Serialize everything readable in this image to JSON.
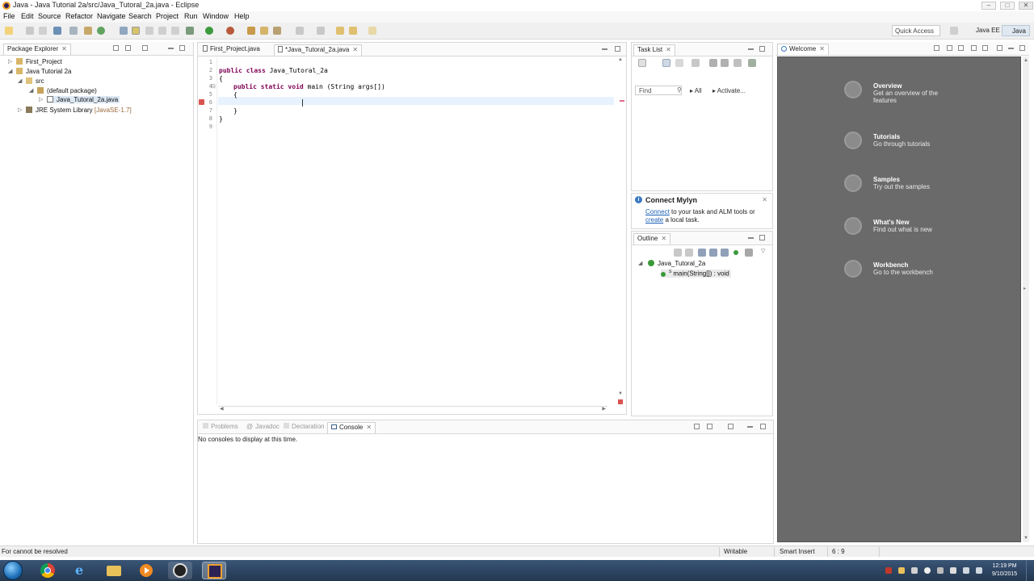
{
  "window": {
    "title": "Java - Java Tutorial 2a/src/Java_Tutoral_2a.java - Eclipse"
  },
  "menu": [
    "File",
    "Edit",
    "Source",
    "Refactor",
    "Navigate",
    "Search",
    "Project",
    "Run",
    "Window",
    "Help"
  ],
  "toolbar": {
    "quick_access_placeholder": "Quick Access",
    "perspectives": [
      "Java EE",
      "Java"
    ]
  },
  "package_explorer": {
    "title": "Package Explorer",
    "tree": [
      {
        "label": "First_Project"
      },
      {
        "label": "Java Tutorial 2a"
      },
      {
        "label": "src"
      },
      {
        "label": "(default package)"
      },
      {
        "label": "Java_Tutoral_2a.java"
      },
      {
        "label": "JRE System Library",
        "suffix": "[JavaSE-1.7]"
      }
    ]
  },
  "editor": {
    "tabs": [
      {
        "label": "First_Project.java"
      },
      {
        "label": "*Java_Tutoral_2a.java"
      }
    ],
    "lines": [
      {
        "n": "1",
        "text": ""
      },
      {
        "n": "2",
        "kw": "public class",
        "text": " Java_Tutoral_2a"
      },
      {
        "n": "3",
        "text": "{"
      },
      {
        "n": "4",
        "kw": "public static void",
        "text": " main (String args[])"
      },
      {
        "n": "5",
        "text": "{"
      },
      {
        "n": "6",
        "text": ""
      },
      {
        "n": "7",
        "text": "}"
      },
      {
        "n": "8",
        "text": "}"
      },
      {
        "n": "9",
        "text": ""
      }
    ]
  },
  "task_list": {
    "title": "Task List",
    "find_placeholder": "Find",
    "all_label": "All",
    "activate_label": "Activate..."
  },
  "mylyn": {
    "title": "Connect Mylyn",
    "connect_link": "Connect",
    "line1_rest": " to your task and ALM tools or",
    "create_link": "create",
    "line2_rest": " a local task."
  },
  "outline": {
    "title": "Outline",
    "class_name": "Java_Tutoral_2a",
    "method": "main(String[]) : void",
    "method_superscript": "S"
  },
  "welcome": {
    "title": "Welcome",
    "items": [
      {
        "title": "Overview",
        "desc": "Get an overview of the features"
      },
      {
        "title": "Tutorials",
        "desc": "Go through tutorials"
      },
      {
        "title": "Samples",
        "desc": "Try out the samples"
      },
      {
        "title": "What's New",
        "desc": "Find out what is new"
      },
      {
        "title": "Workbench",
        "desc": "Go to the workbench"
      }
    ]
  },
  "console": {
    "tabs": [
      "Problems",
      "Javadoc",
      "Declaration",
      "Console"
    ],
    "message": "No consoles to display at this time."
  },
  "status": {
    "message": "For cannot be resolved",
    "writable": "Writable",
    "insert_mode": "Smart Insert",
    "position": "6 : 9"
  },
  "taskbar": {
    "time": "12:19 PM",
    "date": "9/10/2015"
  }
}
